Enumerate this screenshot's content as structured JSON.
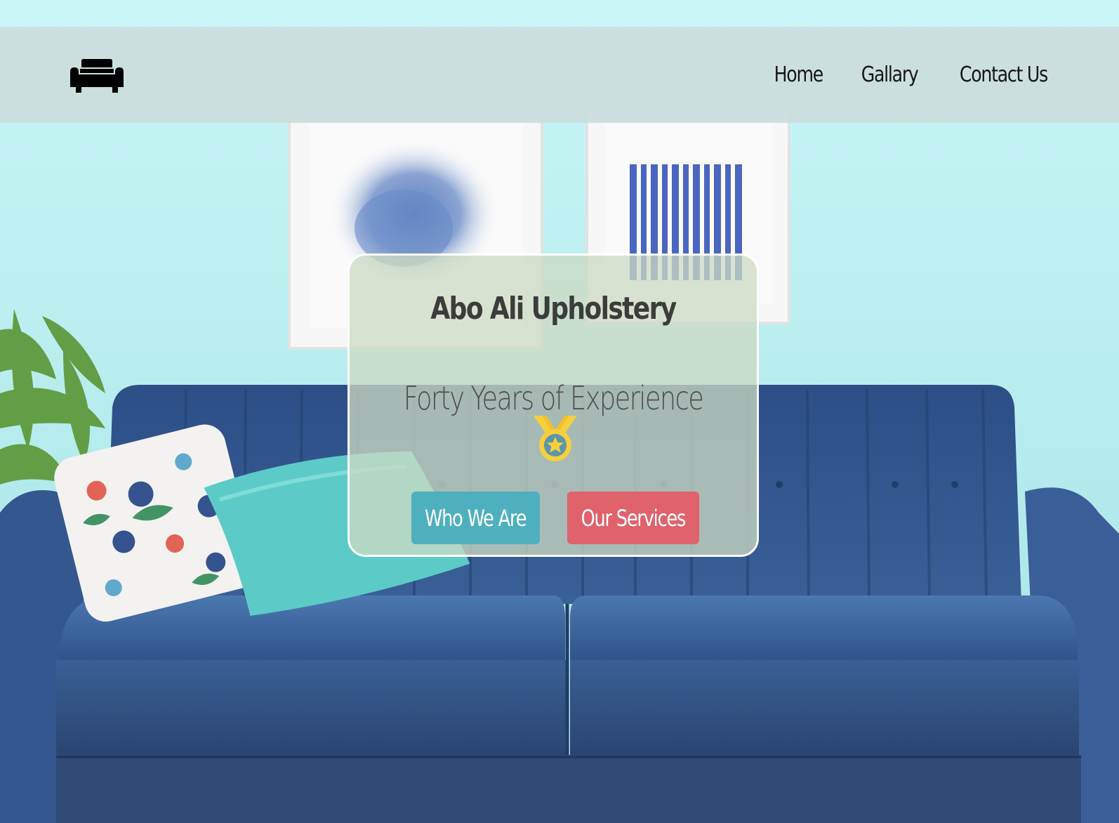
{
  "nav": {
    "logo_icon": "sofa-icon",
    "links": [
      {
        "label": "Home"
      },
      {
        "label": "Gallary"
      },
      {
        "label": "Contact Us"
      }
    ]
  },
  "hero": {
    "title": "Abo Ali Upholstery",
    "subtitle": "Forty Years of Experience",
    "badge_icon": "medal-icon",
    "buttons": {
      "who_label": "Who We Are",
      "services_label": "Our Services"
    }
  },
  "colors": {
    "wall": "#c8f5f5",
    "navbar": "#ccdede",
    "sofa": "#2f4f86",
    "button_primary": "#4eb0bf",
    "button_secondary": "#e0626b",
    "medal": "#f5cf3d"
  }
}
